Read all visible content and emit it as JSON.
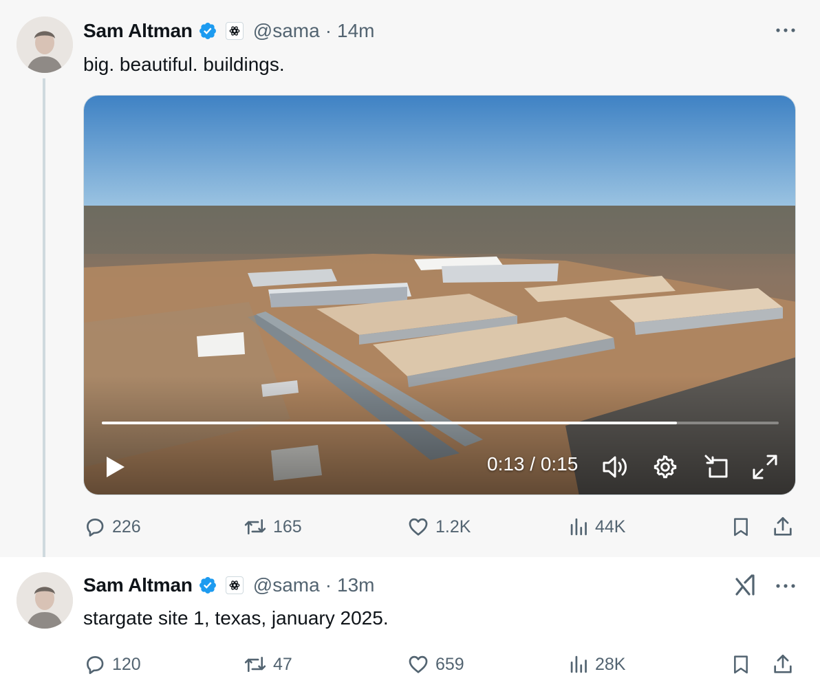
{
  "colors": {
    "verified": "#1d9bf0",
    "secondary_text": "#536471",
    "primary_text": "#0f1419",
    "thread_line": "#cfd9de"
  },
  "tweets": [
    {
      "author_name": "Sam Altman",
      "handle": "@sama",
      "separator": "·",
      "time": "14m",
      "text": "big. beautiful. buildings.",
      "video": {
        "time_readout": "0:13 / 0:15",
        "progress": 0.85,
        "icons": [
          "play-icon",
          "volume-icon",
          "settings-icon",
          "picture-in-picture-icon",
          "fullscreen-icon"
        ]
      },
      "stats": {
        "replies": "226",
        "reposts": "165",
        "likes": "1.2K",
        "views": "44K"
      }
    },
    {
      "author_name": "Sam Altman",
      "handle": "@sama",
      "separator": "·",
      "time": "13m",
      "text": "stargate site 1, texas, january 2025.",
      "stats": {
        "replies": "120",
        "reposts": "47",
        "likes": "659",
        "views": "28K"
      }
    }
  ]
}
